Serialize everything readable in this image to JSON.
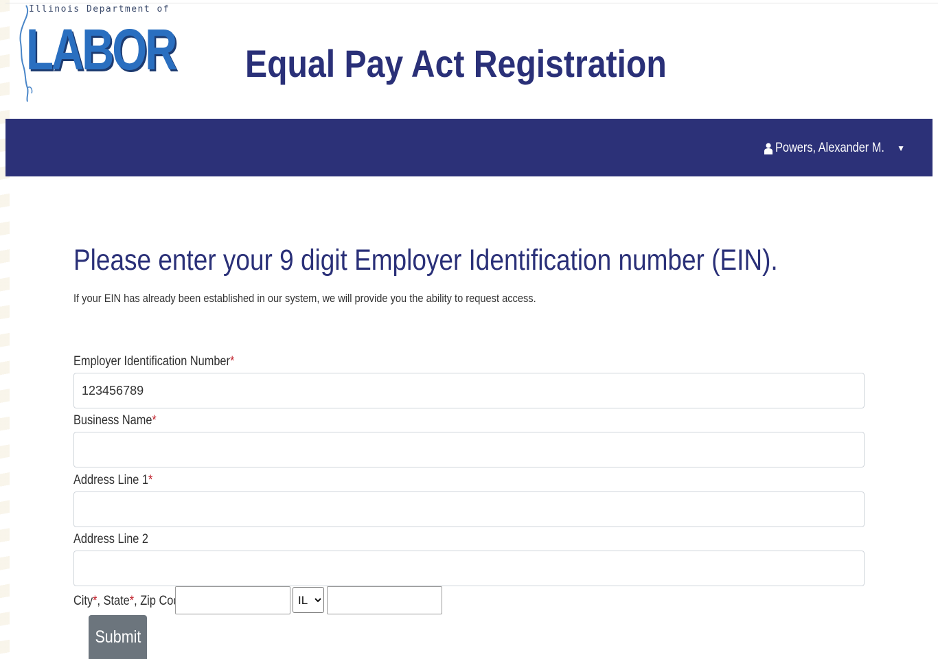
{
  "header": {
    "logo_top_text": "Illinois Department of",
    "logo_word": "LABOR",
    "site_title": "Equal Pay Act Registration"
  },
  "navbar": {
    "user_name": "Powers, Alexander M.",
    "user_icon": "user-icon",
    "caret_icon": "caret-down-icon",
    "background": "#2c3178"
  },
  "main": {
    "title": "Please enter your 9 digit Employer Identification number (EIN).",
    "subtitle": "If your EIN has already been established in our system, we will provide you the ability to request access."
  },
  "form": {
    "ein": {
      "label": "Employer Identification Number",
      "required_mark": "*",
      "value": "123456789"
    },
    "business_name": {
      "label": "Business Name",
      "required_mark": "*",
      "value": ""
    },
    "address1": {
      "label": "Address Line 1",
      "required_mark": "*",
      "value": ""
    },
    "address2": {
      "label": "Address Line 2",
      "value": ""
    },
    "city_state_zip": {
      "city_label": "City",
      "state_label": ", State",
      "zip_label": ", Zip Code",
      "required_mark": "*",
      "city_value": "",
      "state_value": "IL",
      "zip_value": ""
    },
    "submit_label": "Submit"
  },
  "colors": {
    "brand": "#2a3078",
    "required": "#c0202b",
    "submit": "#6c757d"
  }
}
